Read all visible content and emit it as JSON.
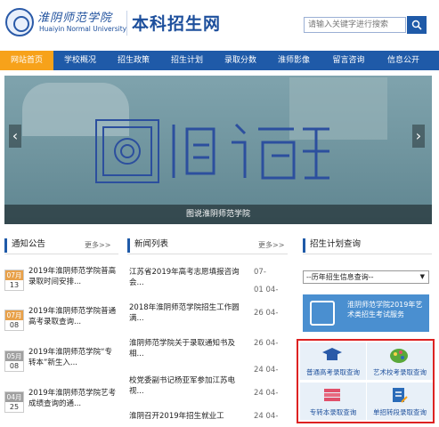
{
  "header": {
    "logo_cn": "淮阴师范学院",
    "logo_en": "Huaiyin Normal University",
    "site_title": "本科招生网",
    "search_placeholder": "请输入关键字进行搜索"
  },
  "nav": [
    {
      "label": "网站首页",
      "active": true
    },
    {
      "label": "学校概况"
    },
    {
      "label": "招生政策"
    },
    {
      "label": "招生计划"
    },
    {
      "label": "录取分数"
    },
    {
      "label": "淮师影像"
    },
    {
      "label": "留言咨询"
    },
    {
      "label": "信息公开"
    }
  ],
  "banner": {
    "text": "图说淮师",
    "caption": "图说淮阴师范学院",
    "prev": "‹",
    "next": "›"
  },
  "notices": {
    "title": "通知公告",
    "more": "更多>>",
    "items": [
      {
        "month": "07月",
        "day": "13",
        "text": "2019年淮阴师范学院普高录取时间安排..."
      },
      {
        "month": "07月",
        "day": "08",
        "text": "2019年淮阴师范学院普通高考录取查询..."
      },
      {
        "month": "05月",
        "day": "08",
        "text": "2019年淮阴师范学院“专转本”新生入...",
        "gray": true
      },
      {
        "month": "04月",
        "day": "25",
        "text": "2019年淮阴师范学院艺考成绩查询的通...",
        "gray": true
      }
    ]
  },
  "news": {
    "title": "新闻列表",
    "more": "更多>>",
    "items": [
      {
        "text": "江苏省2019年高考志愿填报咨询会...",
        "date": "07-",
        "date2": "01 04-"
      },
      {
        "text": "2018年淮阴师范学院招生工作圆满...",
        "date": "26 04-",
        "date2": ""
      },
      {
        "text": "淮阴师范学院关于录取通知书及相...",
        "date": "26 04-",
        "date2": "24 04-"
      },
      {
        "text": "校党委副书记杨亚军参加江苏电视...",
        "date": "24 04-",
        "date2": ""
      },
      {
        "text": "淮阴召开2019年招生就业工",
        "date": "24 04-",
        "date2": ""
      }
    ]
  },
  "plan": {
    "title": "招生计划查询",
    "select_value": "--历年招生信息查询--",
    "banner_text": "淮阴师范学院2019年艺术类招生考试服务",
    "buttons": [
      {
        "label": "普通高考录取查询",
        "icon": "graduation-cap-icon",
        "color": "#2a5aa8"
      },
      {
        "label": "艺术校考录取查询",
        "icon": "palette-icon",
        "color": "#5aa83a"
      },
      {
        "label": "专转本录取查询",
        "icon": "books-icon",
        "color": "#e0506a"
      },
      {
        "label": "单招转段录取查询",
        "icon": "document-edit-icon",
        "color": "#2a6bb8"
      }
    ]
  }
}
